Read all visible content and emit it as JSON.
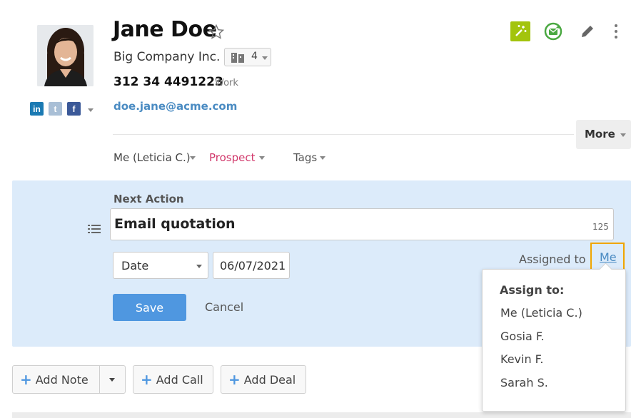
{
  "contact": {
    "name": "Jane Doe",
    "company": "Big Company Inc.",
    "company_count": "4",
    "phone": "312 34 4491223",
    "phone_type": "Work",
    "email": "doe.jane@acme.com"
  },
  "social": {
    "linkedin": "in",
    "twitter": "t",
    "facebook": "f"
  },
  "header_actions": {
    "more_label": "More"
  },
  "meta": {
    "owner": "Me (Leticia C.)",
    "status": "Prospect",
    "tags": "Tags"
  },
  "next_action": {
    "label": "Next Action",
    "value": "Email quotation",
    "char_count": "125",
    "date_type": "Date",
    "date_value": "06/07/2021",
    "save_label": "Save",
    "cancel_label": "Cancel",
    "assigned_label": "Assigned to",
    "assigned_value": "Me"
  },
  "assign_menu": {
    "title": "Assign to:",
    "items": [
      "Me (Leticia C.)",
      "Gosia F.",
      "Kevin F.",
      "Sarah S."
    ]
  },
  "bottom_actions": {
    "add_note": "Add Note",
    "add_call": "Add Call",
    "add_deal": "Add Deal"
  },
  "colors": {
    "accent": "#4f97e0",
    "prospect": "#d1386b",
    "panel": "#dcebfa",
    "highlight": "#f0a500",
    "wand": "#a3c40d",
    "sync": "#4aa841"
  }
}
